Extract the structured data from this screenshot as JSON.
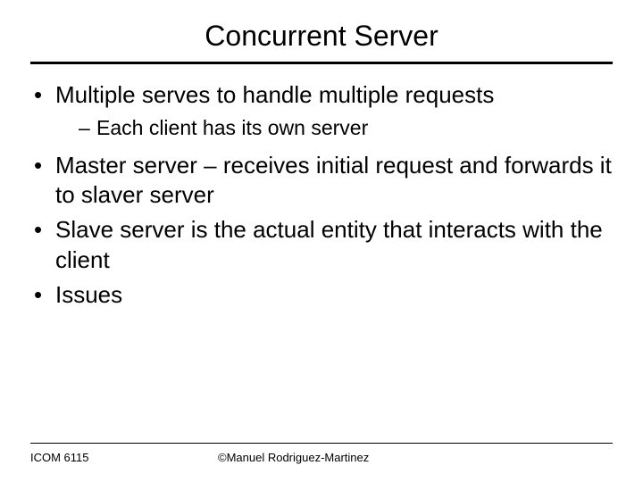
{
  "title": "Concurrent Server",
  "bullets": {
    "b1": "Multiple serves to handle multiple requests",
    "b1_sub1": "Each client has its own server",
    "b2": "Master server – receives initial request and forwards it to slaver server",
    "b3": "Slave server is the actual entity that interacts with the client",
    "b4": "Issues"
  },
  "footer": {
    "course": "ICOM 6115",
    "copyright": "©Manuel Rodriguez-Martinez"
  }
}
